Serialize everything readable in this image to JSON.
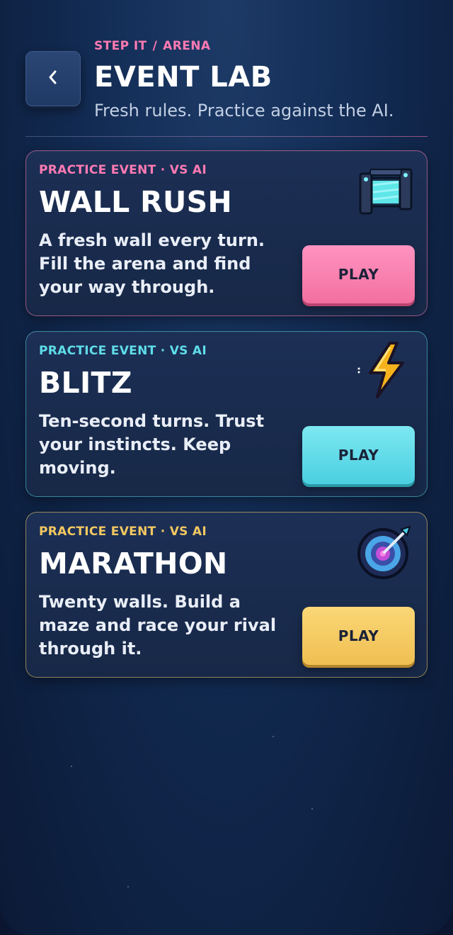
{
  "header": {
    "breadcrumb": {
      "root": "STEP IT",
      "separator": "/",
      "current": "ARENA"
    },
    "title": "EVENT LAB",
    "subtitle": "Fresh rules. Practice against the AI.",
    "back_icon": "chevron-left-icon"
  },
  "events": [
    {
      "tag": "PRACTICE EVENT · VS AI",
      "title": "WALL RUSH",
      "description": "A fresh wall every turn. Fill the arena and find your way through.",
      "play_label": "PLAY",
      "icon": "wall-block-icon",
      "accent": "#ff7ab3"
    },
    {
      "tag": "PRACTICE EVENT · VS AI",
      "title": "BLITZ",
      "description": "Ten-second turns. Trust your instincts. Keep moving.",
      "play_label": "PLAY",
      "icon": "lightning-bolt-icon",
      "accent": "#5fdde9"
    },
    {
      "tag": "PRACTICE EVENT · VS AI",
      "title": "MARATHON",
      "description": "Twenty walls. Build a maze and race your rival through it.",
      "play_label": "PLAY",
      "icon": "target-dart-icon",
      "accent": "#f2c861"
    }
  ]
}
